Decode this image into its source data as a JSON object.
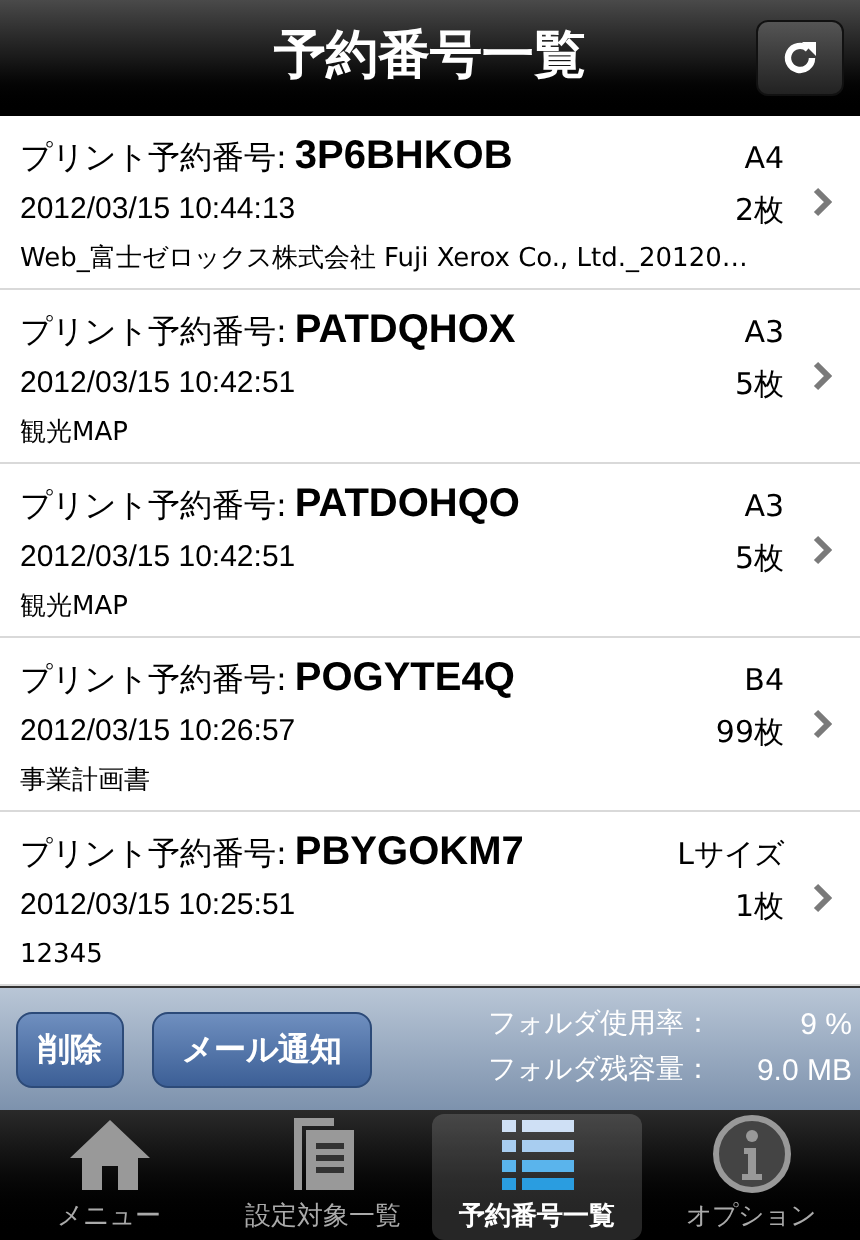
{
  "nav_bar": {
    "title": "予約番号一覧"
  },
  "reservations": [
    {
      "label": "プリント予約番号:",
      "code": "3P6BHKOB",
      "datetime": "2012/03/15 10:44:13",
      "paper": "A4",
      "copies": "2枚",
      "name": "Web_富士ゼロックス株式会社 Fuji Xerox Co., Ltd._20120…"
    },
    {
      "label": "プリント予約番号:",
      "code": "PATDQHOX",
      "datetime": "2012/03/15 10:42:51",
      "paper": "A3",
      "copies": "5枚",
      "name": "観光MAP"
    },
    {
      "label": "プリント予約番号:",
      "code": "PATDOHQO",
      "datetime": "2012/03/15 10:42:51",
      "paper": "A3",
      "copies": "5枚",
      "name": "観光MAP"
    },
    {
      "label": "プリント予約番号:",
      "code": "POGYTE4Q",
      "datetime": "2012/03/15 10:26:57",
      "paper": "B4",
      "copies": "99枚",
      "name": "事業計画書"
    },
    {
      "label": "プリント予約番号:",
      "code": "PBYGOKM7",
      "datetime": "2012/03/15 10:25:51",
      "paper": "Lサイズ",
      "copies": "1枚",
      "name": "12345"
    }
  ],
  "toolbar": {
    "buttons": [
      "削除",
      "メール通知"
    ],
    "stats": [
      {
        "label": "フォルダ使用率：",
        "value": "9 %"
      },
      {
        "label": "フォルダ残容量：",
        "value": "9.0 MB"
      }
    ]
  },
  "tab_bar": [
    {
      "kind": "home",
      "label": "メニュー",
      "selected": false
    },
    {
      "kind": "document",
      "label": "設定対象一覧",
      "selected": false
    },
    {
      "kind": "list",
      "label": "予約番号一覧",
      "selected": true
    },
    {
      "kind": "info",
      "label": "オプション",
      "selected": false
    }
  ]
}
